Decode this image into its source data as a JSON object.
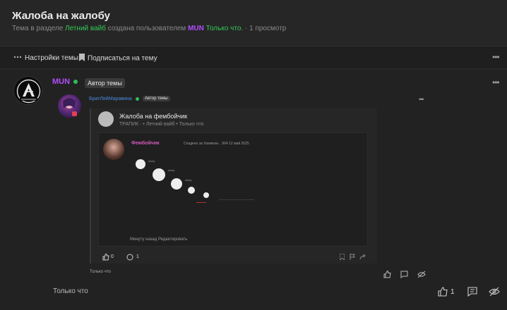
{
  "thread": {
    "title": "Жалоба на жалобу",
    "meta_prefix": "Тема в разделе",
    "section": "Летний вайб",
    "meta_middle": "создана пользователем",
    "creator": "MUN",
    "created": "Только что.",
    "views": "· 1 просмотр"
  },
  "actions": {
    "settings": "Настройки темы",
    "subscribe": "Подписаться на тему"
  },
  "post": {
    "author": "MUN",
    "author_badge": "Автор темы",
    "time": "Только что",
    "likes": "1"
  },
  "quote": {
    "author": "БратЛейМаравина",
    "badge": "Автор темы",
    "time": "Только что",
    "likes": "0",
    "comments": "1",
    "inner": {
      "title": "Жалоба на фембойчик",
      "meta": "ТРАПИК · • Летний вайб • Только что",
      "shot_user": "Фембойчик",
      "shot_meta": "Спадено за Хомяком...   964   12 май 2025",
      "shot_names": [
        "sindy",
        "sindy",
        "sindy"
      ],
      "shot_footer": "Минуту назад   Редактировать"
    }
  },
  "colors": {
    "accent_green": "#33cc55",
    "accent_violet": "#b34dff",
    "link_blue": "#4a8ae0"
  }
}
